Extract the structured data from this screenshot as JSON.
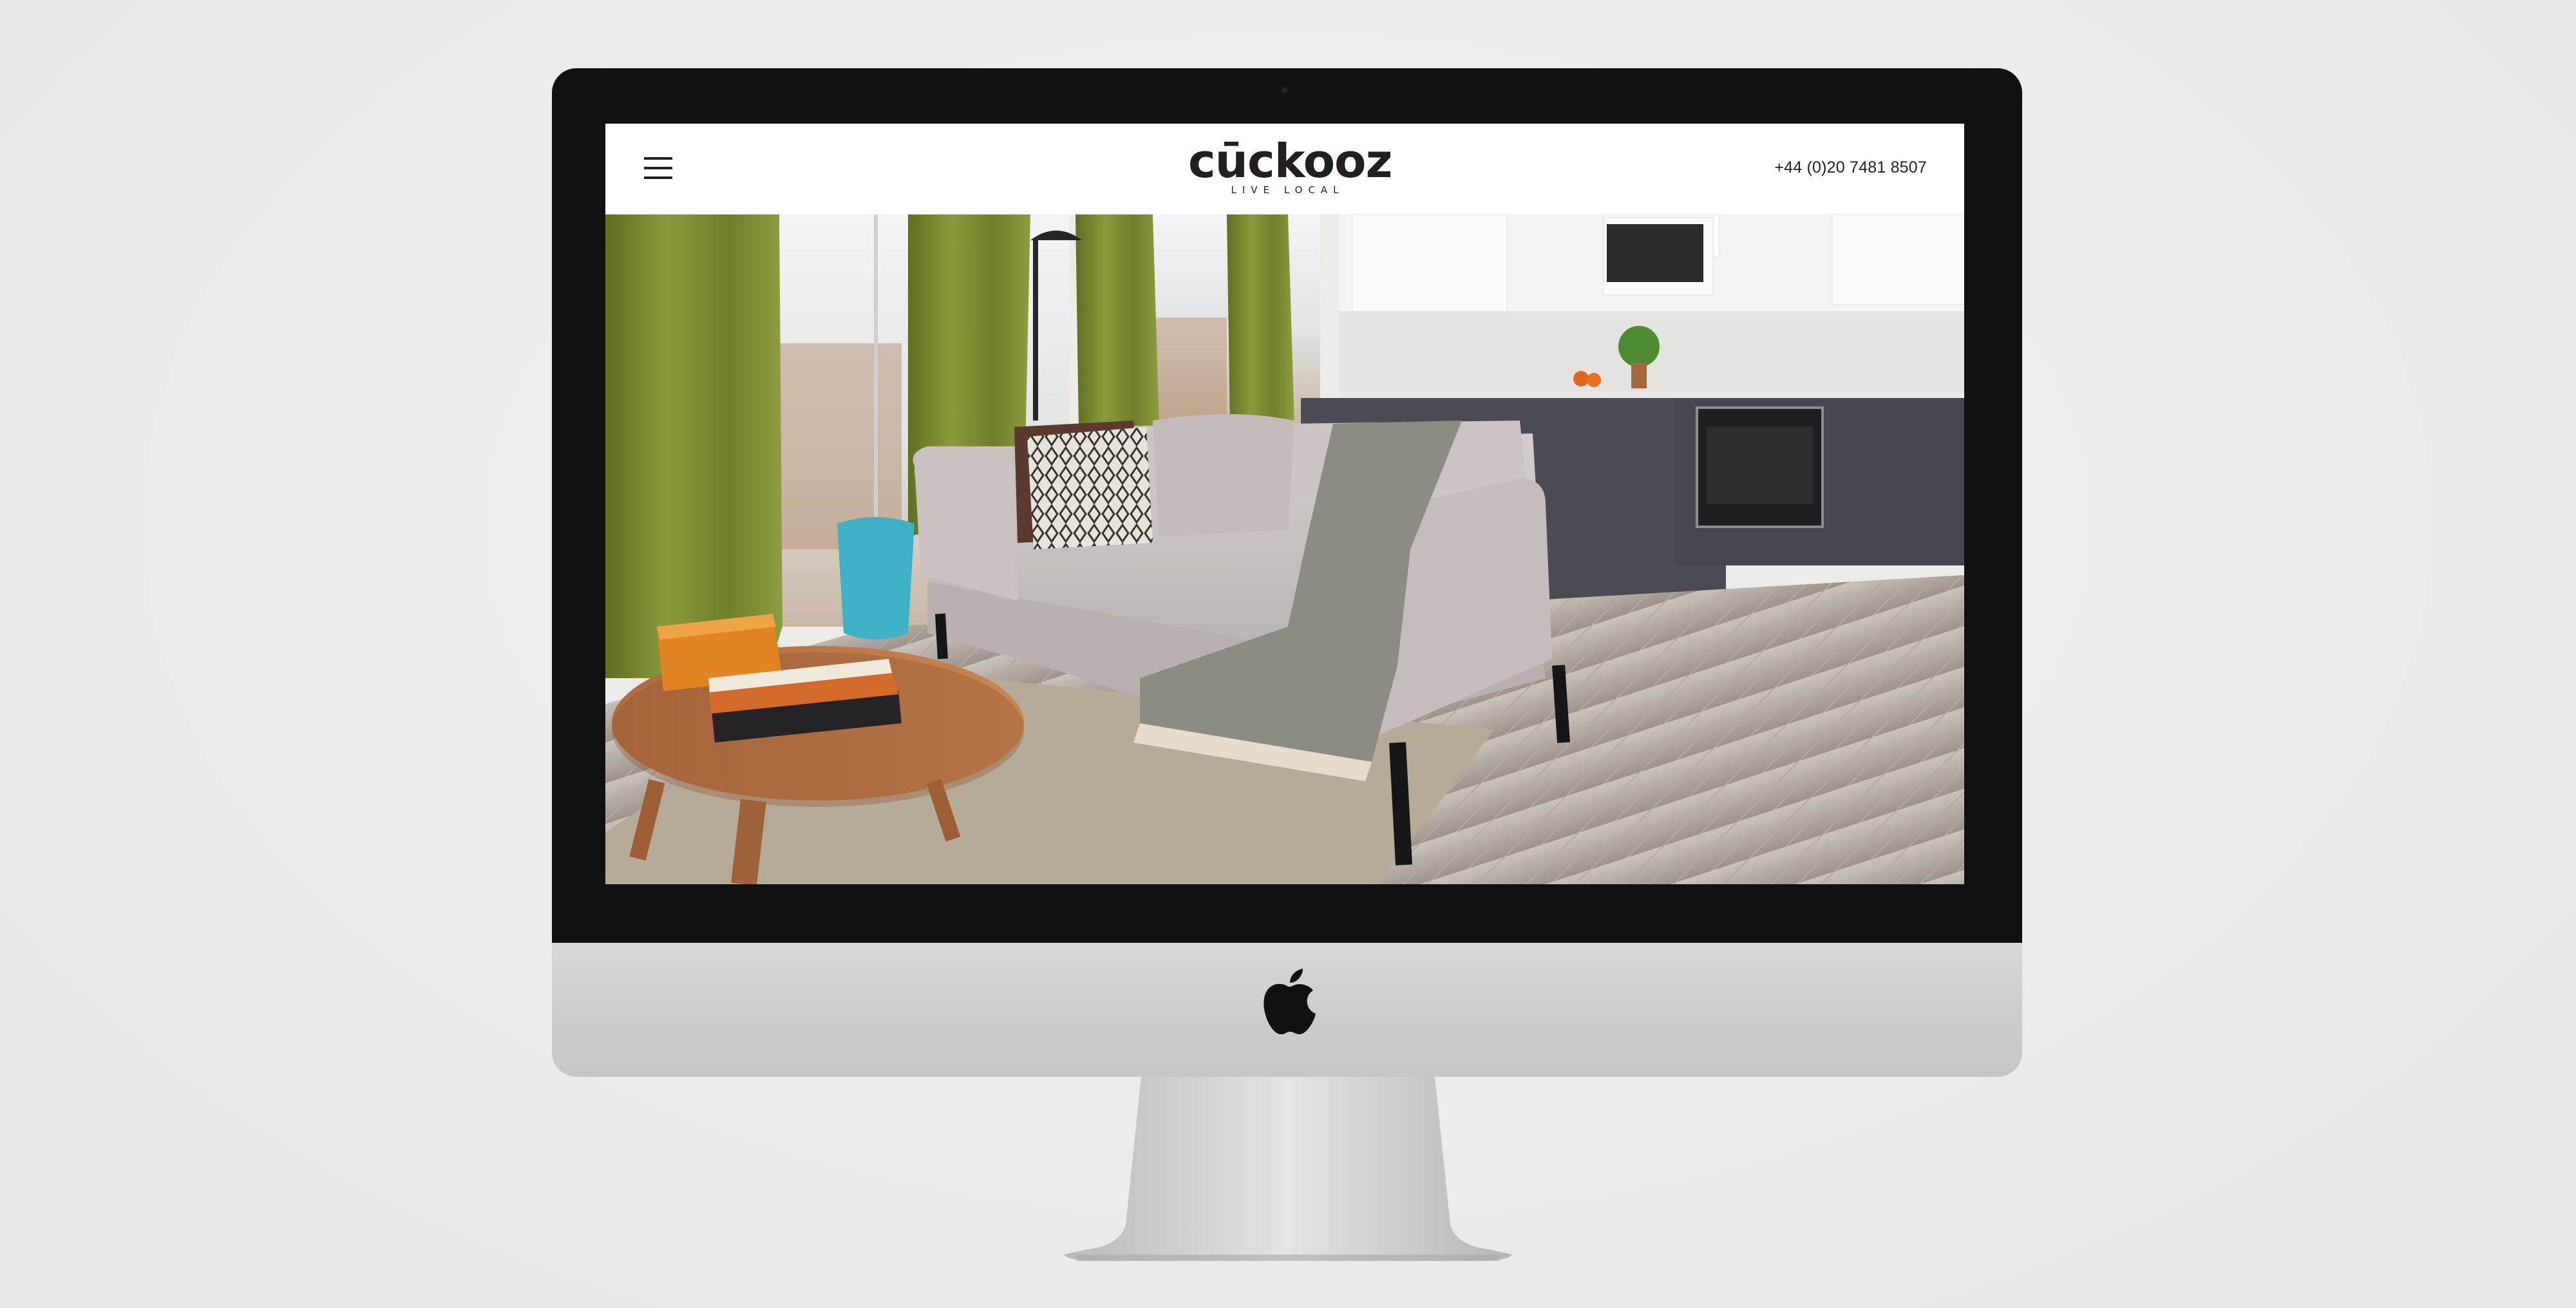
{
  "device": {
    "name": "iMac",
    "logo_icon": "apple-icon"
  },
  "site": {
    "brand": {
      "name": "cūckooz",
      "tagline": "LIVE LOCAL"
    },
    "header": {
      "menu_icon": "hamburger-menu-icon",
      "phone": "+44 (0)20 7481 8507"
    },
    "hero": {
      "image": "living-room-with-open-kitchen-photo"
    }
  },
  "colors": {
    "bezel": "#111113",
    "header_bg": "#ffffff",
    "curtain": "#7a8a2e",
    "sofa": "#c9c3c3"
  }
}
